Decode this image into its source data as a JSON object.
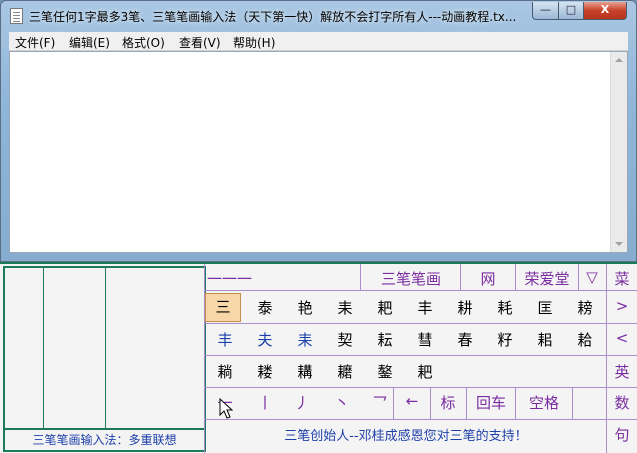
{
  "window": {
    "title": "三笔任何1字最多3笔、三笔笔画输入法（天下第一快）解放不会打字所有人---动画教程.tx...",
    "min_label": "—",
    "max_label": "□",
    "close_label": "X"
  },
  "menu": [
    "文件(F)",
    "编辑(E)",
    "格式(O)",
    "查看(V)",
    "帮助(H)"
  ],
  "ime": {
    "strokes_input": "一一一",
    "brand": "三笔笔画",
    "net": "网",
    "rongaitang": "荣爱堂",
    "dropdown": "▽",
    "row1": [
      "三",
      "泰",
      "艳",
      "耒",
      "耙",
      "丰",
      "耕",
      "耗",
      "匡",
      "耪"
    ],
    "row2": [
      "丰",
      "夫",
      "耒",
      "契",
      "耘",
      "彗",
      "春",
      "籽",
      "耜",
      "耠"
    ],
    "row3": [
      "耥",
      "耧",
      "耩",
      "耱",
      "鏊",
      "耙"
    ],
    "strokes": [
      "一",
      "丨",
      "丿",
      "丶",
      "乛",
      "←"
    ],
    "punct": "标",
    "enter": "回车",
    "space": "空格",
    "side": [
      "菜",
      ">",
      "<",
      "英",
      "数",
      "句"
    ],
    "footer": "三笔创始人--邓桂成感恩您对三笔的支持！",
    "left_status": "三笔笔画输入法：多重联想"
  },
  "colors": {
    "accent_green": "#1d7a5c",
    "purple": "#7a2ca0",
    "blue": "#1d3faa",
    "selected": "#f7d7a8"
  }
}
